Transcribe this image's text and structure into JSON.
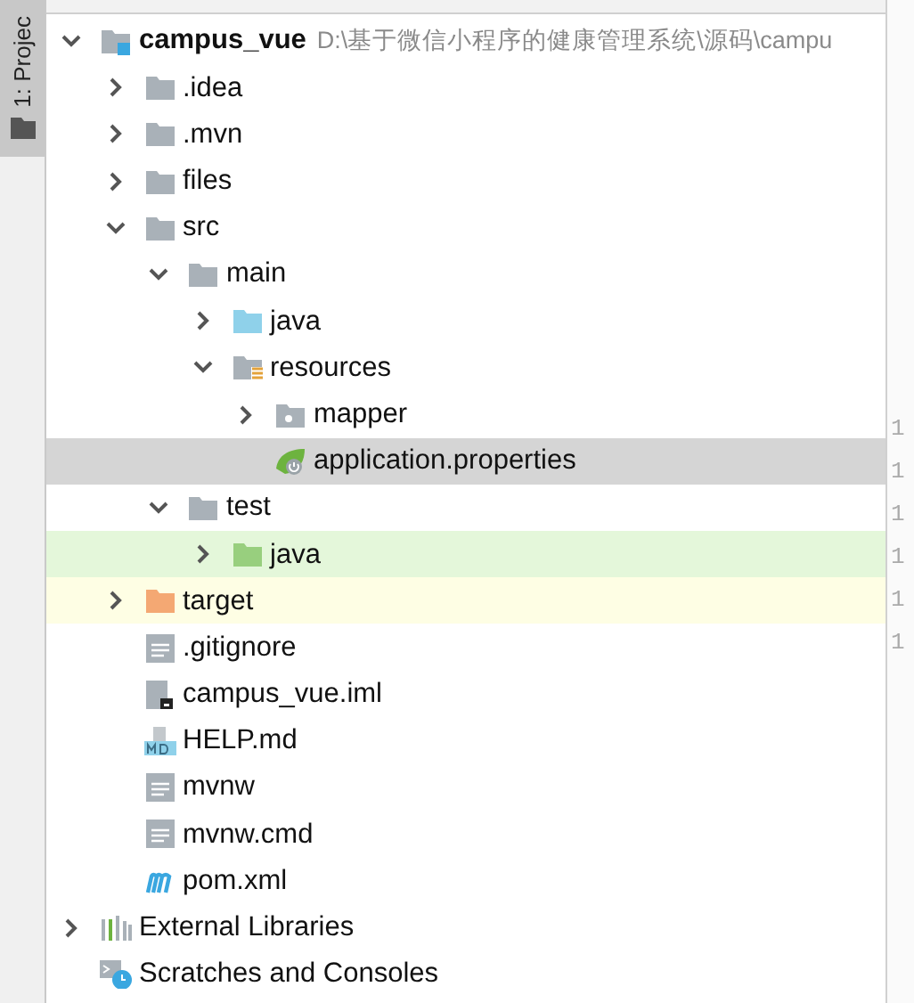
{
  "tool_window_tab": {
    "label": "1: Projec",
    "selected": true
  },
  "tree": [
    {
      "name": "campus_vue",
      "kind": "module",
      "path": "D:\\基于微信小程序的健康管理系统\\源码\\campu",
      "expanded": true,
      "selected": false,
      "children": [
        {
          "name": ".idea",
          "kind": "folder",
          "expanded": false,
          "selected": false
        },
        {
          "name": ".mvn",
          "kind": "folder",
          "expanded": false,
          "selected": false
        },
        {
          "name": "files",
          "kind": "folder",
          "expanded": false,
          "selected": false
        },
        {
          "name": "src",
          "kind": "folder",
          "expanded": true,
          "selected": false,
          "children": [
            {
              "name": "main",
              "kind": "folder",
              "expanded": true,
              "selected": false,
              "children": [
                {
                  "name": "java",
                  "kind": "source-folder",
                  "expanded": false,
                  "selected": false
                },
                {
                  "name": "resources",
                  "kind": "resources-folder",
                  "expanded": true,
                  "selected": false,
                  "children": [
                    {
                      "name": "mapper",
                      "kind": "package-folder",
                      "expanded": false,
                      "selected": false
                    },
                    {
                      "name": "application.properties",
                      "kind": "spring-file",
                      "selected": true
                    }
                  ]
                }
              ]
            },
            {
              "name": "test",
              "kind": "folder",
              "expanded": true,
              "selected": false,
              "children": [
                {
                  "name": "java",
                  "kind": "test-folder",
                  "expanded": false,
                  "selected": false
                }
              ]
            }
          ]
        },
        {
          "name": "target",
          "kind": "excluded-folder",
          "expanded": false,
          "selected": false
        },
        {
          "name": ".gitignore",
          "kind": "text-file",
          "selected": false
        },
        {
          "name": "campus_vue.iml",
          "kind": "iml-file",
          "selected": false
        },
        {
          "name": "HELP.md",
          "kind": "markdown-file",
          "selected": false
        },
        {
          "name": "mvnw",
          "kind": "text-file",
          "selected": false
        },
        {
          "name": "mvnw.cmd",
          "kind": "text-file",
          "selected": false
        },
        {
          "name": "pom.xml",
          "kind": "maven-file",
          "selected": false
        }
      ]
    },
    {
      "name": "External Libraries",
      "kind": "libraries",
      "expanded": false,
      "selected": false
    },
    {
      "name": "Scratches and Consoles",
      "kind": "scratches",
      "selected": false
    }
  ],
  "gutter_line_numbers": [
    "1",
    "1",
    "1",
    "1",
    "1",
    "1"
  ]
}
